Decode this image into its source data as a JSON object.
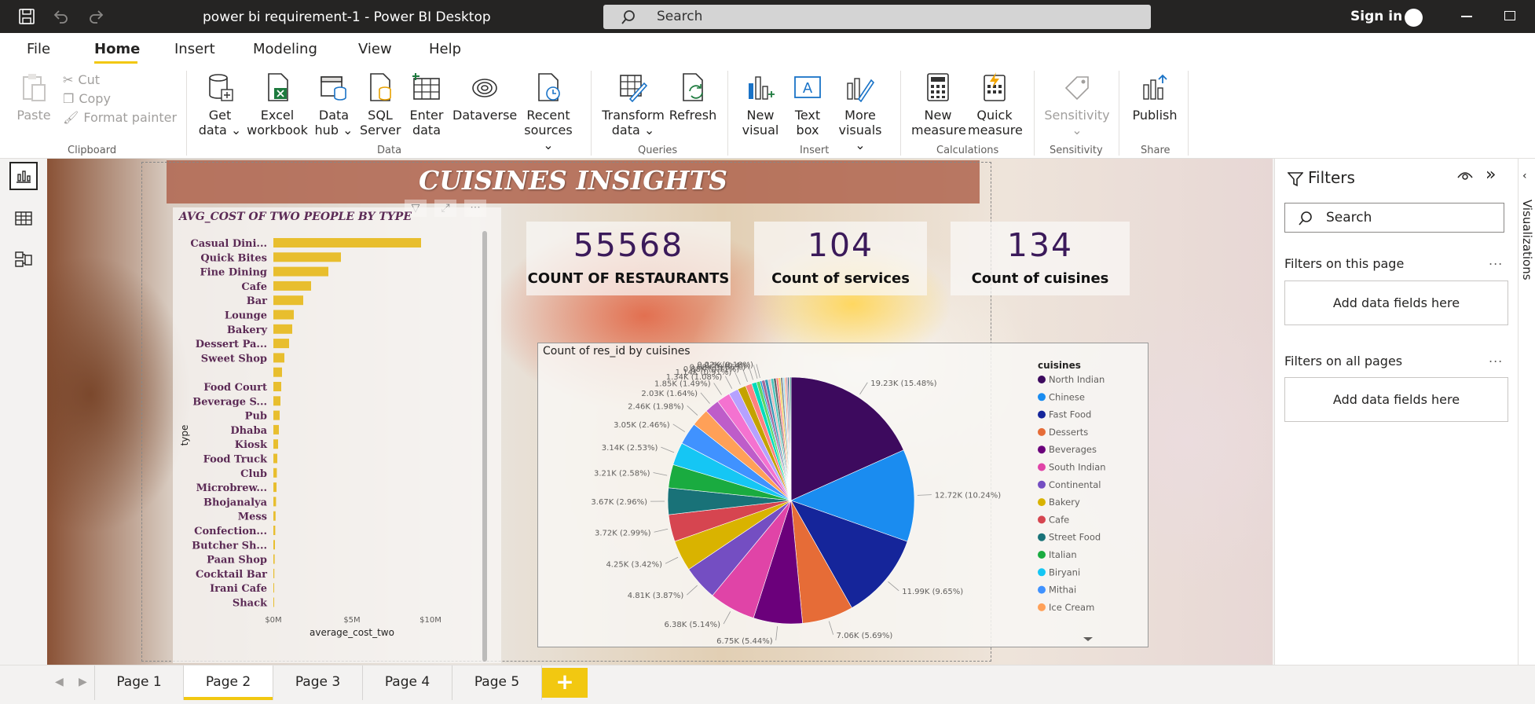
{
  "titlebar": {
    "title": "power bi requirement-1 - Power BI Desktop",
    "search_placeholder": "Search",
    "signin": "Sign in"
  },
  "menu": [
    "File",
    "Home",
    "Insert",
    "Modeling",
    "View",
    "Help"
  ],
  "ribbon": {
    "clipboard": {
      "paste": "Paste",
      "cut": "Cut",
      "copy": "Copy",
      "format_painter": "Format painter",
      "label": "Clipboard"
    },
    "data": {
      "label": "Data",
      "buttons": [
        [
          "Get",
          "data ⌄"
        ],
        [
          "Excel",
          "workbook"
        ],
        [
          "Data",
          "hub ⌄"
        ],
        [
          "SQL",
          "Server"
        ],
        [
          "Enter",
          "data"
        ],
        [
          "Dataverse",
          ""
        ],
        [
          "Recent",
          "sources ⌄"
        ]
      ]
    },
    "queries": {
      "label": "Queries",
      "transform": [
        "Transform",
        "data ⌄"
      ],
      "refresh": "Refresh"
    },
    "insert": {
      "label": "Insert",
      "buttons": [
        [
          "New",
          "visual"
        ],
        [
          "Text",
          "box"
        ],
        [
          "More",
          "visuals ⌄"
        ]
      ]
    },
    "calculations": {
      "label": "Calculations",
      "buttons": [
        [
          "New",
          "measure"
        ],
        [
          "Quick",
          "measure"
        ]
      ]
    },
    "sensitivity": {
      "label": "Sensitivity",
      "button": [
        "Sensitivity",
        "⌄"
      ]
    },
    "share": {
      "label": "Share",
      "button": "Publish"
    }
  },
  "report": {
    "banner_title": "CUISINES INSIGHTS",
    "cards": [
      {
        "value": "55568",
        "label": "COUNT OF RESTAURANTS"
      },
      {
        "value": "104",
        "label": "Count of services"
      },
      {
        "value": "134",
        "label": "Count of cuisines"
      }
    ]
  },
  "chart_data": [
    {
      "type": "bar",
      "orientation": "horizontal",
      "title": "AVG_COST OF TWO PEOPLE BY TYPE",
      "xlabel": "average_cost_two",
      "ylabel": "type",
      "x_ticks": [
        "$0M",
        "$5M",
        "$10M"
      ],
      "xlim": [
        0,
        10
      ],
      "color": "#e8be2e",
      "categories": [
        "Casual Dini...",
        "Quick Bites",
        "Fine Dining",
        "Cafe",
        "Bar",
        "Lounge",
        "Bakery",
        "Dessert Pa...",
        "Sweet Shop",
        "",
        "Food Court",
        "Beverage S...",
        "Pub",
        "Dhaba",
        "Kiosk",
        "Food Truck",
        "Club",
        "Microbrew...",
        "Bhojanalya",
        "Mess",
        "Confection...",
        "Butcher Sh...",
        "Paan Shop",
        "Cocktail Bar",
        "Irani Cafe",
        "Shack"
      ],
      "values": [
        9.4,
        4.3,
        3.5,
        2.4,
        1.9,
        1.3,
        1.2,
        1.0,
        0.7,
        0.55,
        0.5,
        0.45,
        0.4,
        0.35,
        0.3,
        0.25,
        0.22,
        0.2,
        0.17,
        0.14,
        0.12,
        0.1,
        0.08,
        0.06,
        0.05,
        0.04
      ]
    },
    {
      "type": "pie",
      "title": "Count of res_id by cuisines",
      "legend_title": "cuisines",
      "legend_position": "right",
      "legend": [
        {
          "name": "North Indian",
          "color": "#3d0a5e"
        },
        {
          "name": "Chinese",
          "color": "#1a8cf0"
        },
        {
          "name": "Fast Food",
          "color": "#15259a"
        },
        {
          "name": "Desserts",
          "color": "#e66c37"
        },
        {
          "name": "Beverages",
          "color": "#6b007b"
        },
        {
          "name": "South Indian",
          "color": "#e044a7"
        },
        {
          "name": "Continental",
          "color": "#744ec2"
        },
        {
          "name": "Bakery",
          "color": "#d9b300"
        },
        {
          "name": "Cafe",
          "color": "#d64550"
        },
        {
          "name": "Street Food",
          "color": "#197278"
        },
        {
          "name": "Italian",
          "color": "#1aab40"
        },
        {
          "name": "Biryani",
          "color": "#15c6f4"
        },
        {
          "name": "Mithai",
          "color": "#4092ff"
        },
        {
          "name": "Ice Cream",
          "color": "#ffa058"
        }
      ],
      "slices": [
        {
          "value": 19.23,
          "label": "19.23K (15.48%)",
          "color": "#3d0a5e"
        },
        {
          "value": 12.72,
          "label": "12.72K (10.24%)",
          "color": "#1a8cf0"
        },
        {
          "value": 11.99,
          "label": "11.99K (9.65%)",
          "color": "#15259a"
        },
        {
          "value": 7.06,
          "label": "7.06K (5.69%)",
          "color": "#e66c37"
        },
        {
          "value": 6.75,
          "label": "6.75K (5.44%)",
          "color": "#6b007b"
        },
        {
          "value": 6.38,
          "label": "6.38K (5.14%)",
          "color": "#e044a7"
        },
        {
          "value": 4.81,
          "label": "4.81K (3.87%)",
          "color": "#744ec2"
        },
        {
          "value": 4.25,
          "label": "4.25K (3.42%)",
          "color": "#d9b300"
        },
        {
          "value": 3.72,
          "label": "3.72K (2.99%)",
          "color": "#d64550"
        },
        {
          "value": 3.67,
          "label": "3.67K (2.96%)",
          "color": "#197278"
        },
        {
          "value": 3.21,
          "label": "3.21K (2.58%)",
          "color": "#1aab40"
        },
        {
          "value": 3.14,
          "label": "3.14K (2.53%)",
          "color": "#15c6f4"
        },
        {
          "value": 3.05,
          "label": "3.05K (2.46%)",
          "color": "#4092ff"
        },
        {
          "value": 2.46,
          "label": "2.46K (1.98%)",
          "color": "#ffa058"
        },
        {
          "value": 2.03,
          "label": "2.03K (1.64%)",
          "color": "#be5dc9"
        },
        {
          "value": 1.85,
          "label": "1.85K (1.49%)",
          "color": "#f472d0"
        },
        {
          "value": 1.34,
          "label": "1.34K (1.08%)",
          "color": "#b5a1ff"
        },
        {
          "value": 1.14,
          "label": "1.14K (0.91%)",
          "color": "#c4a200"
        },
        {
          "value": 0.88,
          "label": "0.88K (0.71%)",
          "color": "#ff8080"
        },
        {
          "value": 0.68,
          "label": "0.68K (0.55%)",
          "color": "#00dbbc"
        },
        {
          "value": 0.5,
          "label": "0.5K (0.4%)",
          "color": "#5bd667"
        },
        {
          "value": 0.22,
          "label": "0.22K (0.18%)",
          "color": "#0091d5"
        }
      ],
      "tail_slices": [
        {
          "value": 0.45,
          "color": "#a66999"
        },
        {
          "value": 0.42,
          "color": "#3599b8"
        },
        {
          "value": 0.4,
          "color": "#dfbfbf"
        },
        {
          "value": 0.38,
          "color": "#4ac5bb"
        },
        {
          "value": 0.35,
          "color": "#5f6b6d"
        },
        {
          "value": 0.32,
          "color": "#fb8281"
        },
        {
          "value": 0.3,
          "color": "#f4d25a"
        },
        {
          "value": 0.28,
          "color": "#7f898a"
        },
        {
          "value": 0.25,
          "color": "#a4ddee"
        },
        {
          "value": 0.22,
          "color": "#fdab89"
        },
        {
          "value": 0.2,
          "color": "#b687ac"
        },
        {
          "value": 0.18,
          "color": "#28738a"
        },
        {
          "value": 0.16,
          "color": "#a78f8f"
        },
        {
          "value": 0.14,
          "color": "#168980"
        }
      ]
    }
  ],
  "filters": {
    "title": "Filters",
    "search_placeholder": "Search",
    "on_this_page": "Filters on this page",
    "on_all_pages": "Filters on all pages",
    "well_text": "Add data fields here",
    "more": "..."
  },
  "visualizations_label": "Visualizations",
  "pages": [
    "Page 1",
    "Page 2",
    "Page 3",
    "Page 4",
    "Page 5"
  ],
  "add_page": "+"
}
